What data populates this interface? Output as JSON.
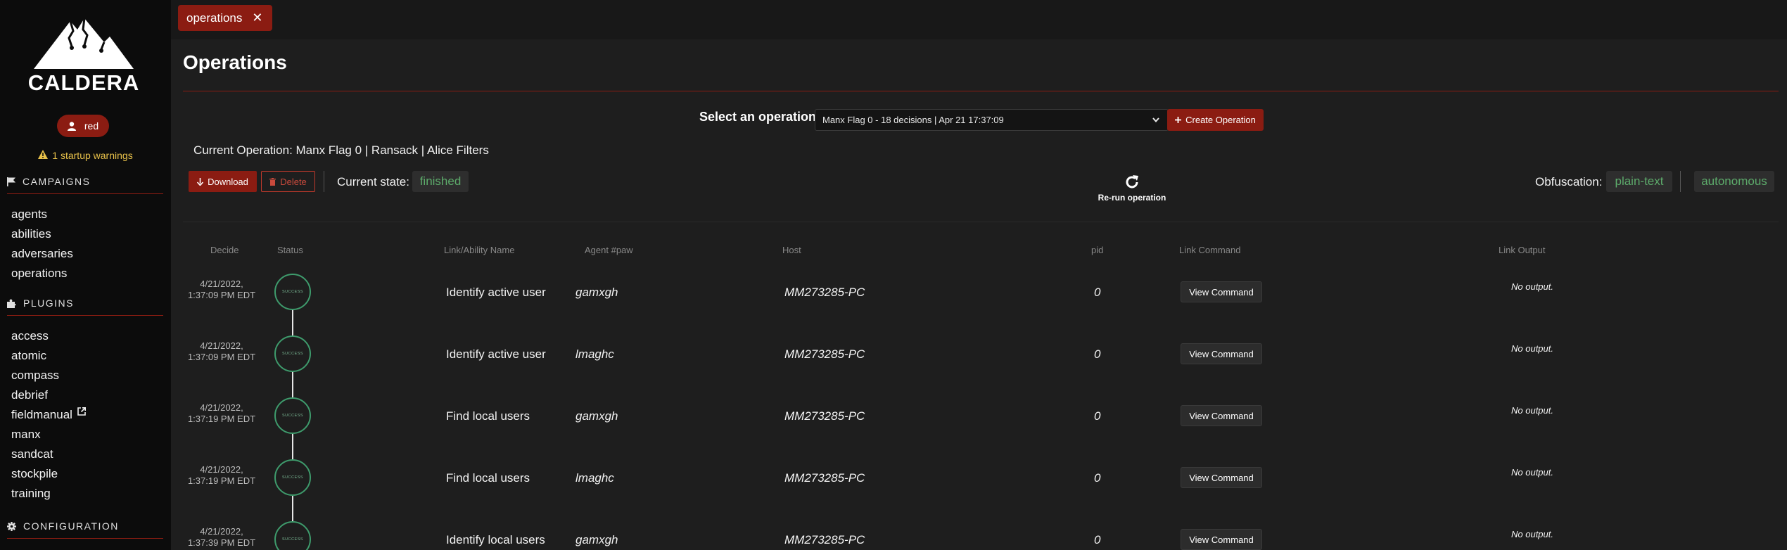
{
  "sidebar": {
    "logo_text": "CALDERA",
    "user": "red",
    "warnings": "1 startup warnings",
    "sections": [
      {
        "title": "CAMPAIGNS",
        "icon": "flag-icon",
        "items": [
          "agents",
          "abilities",
          "adversaries",
          "operations"
        ]
      },
      {
        "title": "PLUGINS",
        "icon": "puzzle-icon",
        "items": [
          "access",
          "atomic",
          "compass",
          "debrief",
          "fieldmanual",
          "manx",
          "sandcat",
          "stockpile",
          "training"
        ]
      },
      {
        "title": "CONFIGURATION",
        "icon": "gear-icon",
        "items": []
      }
    ]
  },
  "tab": {
    "label": "operations",
    "close": "✕"
  },
  "page": {
    "title": "Operations",
    "select_label": "Select an operation",
    "selected_operation": "Manx Flag 0 - 18 decisions | Apr 21 17:37:09",
    "create_button": "Create Operation",
    "current_operation": "Current Operation: Manx Flag 0 | Ransack | Alice Filters",
    "download_button": "Download",
    "delete_button": "Delete",
    "state_label": "Current state:",
    "state_value": "finished",
    "rerun_label": "Re-run operation",
    "obfuscation_label": "Obfuscation:",
    "obfuscation_value": "plain-text",
    "mode_value": "autonomous"
  },
  "table": {
    "headers": [
      "Decide",
      "Status",
      "Link/Ability Name",
      "Agent #paw",
      "Host",
      "pid",
      "Link Command",
      "Link Output"
    ],
    "rows": [
      {
        "date": "4/21/2022,",
        "time": "1:37:09 PM EDT",
        "status": "SUCCESS",
        "name": "Identify active user",
        "paw": "gamxgh",
        "host": "MM273285-PC",
        "pid": "0",
        "command": "View Command",
        "output": "No output."
      },
      {
        "date": "4/21/2022,",
        "time": "1:37:09 PM EDT",
        "status": "SUCCESS",
        "name": "Identify active user",
        "paw": "lmaghc",
        "host": "MM273285-PC",
        "pid": "0",
        "command": "View Command",
        "output": "No output."
      },
      {
        "date": "4/21/2022,",
        "time": "1:37:19 PM EDT",
        "status": "SUCCESS",
        "name": "Find local users",
        "paw": "gamxgh",
        "host": "MM273285-PC",
        "pid": "0",
        "command": "View Command",
        "output": "No output."
      },
      {
        "date": "4/21/2022,",
        "time": "1:37:19 PM EDT",
        "status": "SUCCESS",
        "name": "Find local users",
        "paw": "lmaghc",
        "host": "MM273285-PC",
        "pid": "0",
        "command": "View Command",
        "output": "No output."
      },
      {
        "date": "4/21/2022,",
        "time": "1:37:39 PM EDT",
        "status": "SUCCESS",
        "name": "Identify local users",
        "paw": "gamxgh",
        "host": "MM273285-PC",
        "pid": "0",
        "command": "View Command",
        "output": "No output."
      }
    ]
  },
  "colors": {
    "accent": "#8b1c12",
    "success": "#3e9b6c",
    "state_text": "#5dab6b",
    "warning": "#e8c14a"
  }
}
